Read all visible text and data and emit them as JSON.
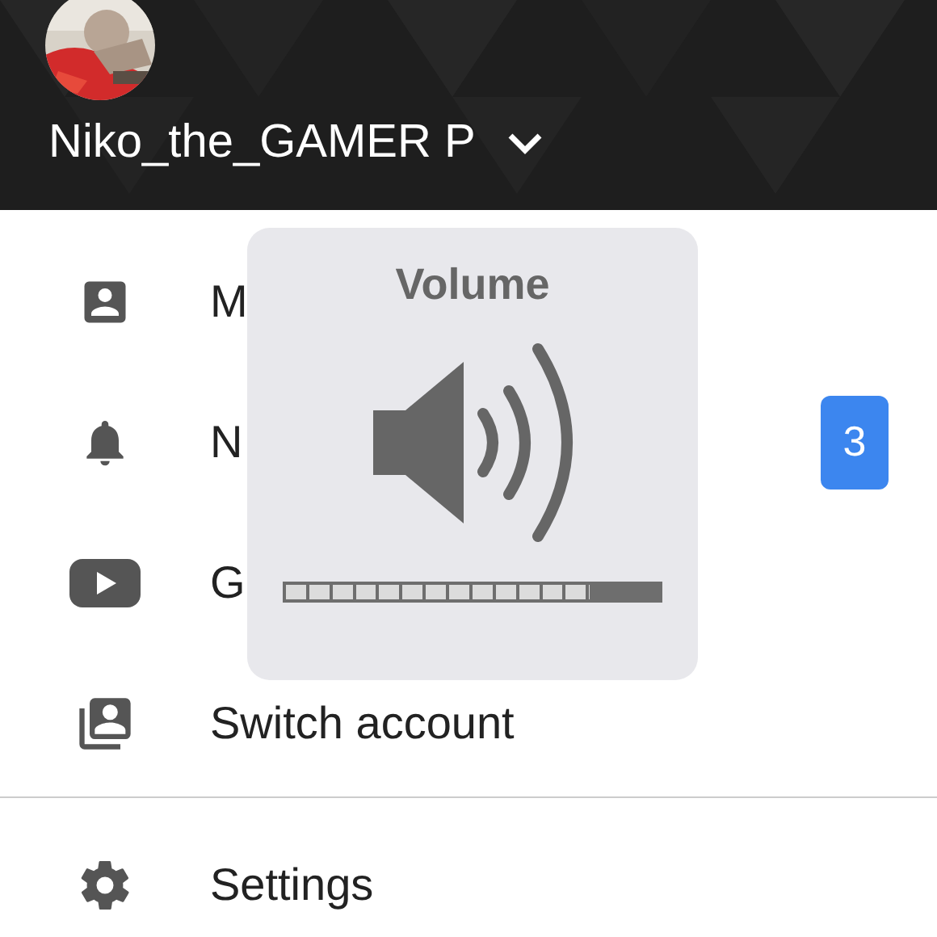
{
  "header": {
    "account_name": "Niko_the_GAMER P"
  },
  "menu_sections": [
    {
      "items": [
        {
          "kind": "account",
          "label": "M"
        },
        {
          "kind": "bell",
          "label": "N",
          "badge": "3"
        },
        {
          "kind": "play",
          "label": "G"
        },
        {
          "kind": "switch",
          "label": "Switch account"
        }
      ]
    },
    {
      "items": [
        {
          "kind": "gear",
          "label": "Settings"
        }
      ]
    }
  ],
  "volume_hud": {
    "title": "Volume",
    "level": 0.8125
  }
}
